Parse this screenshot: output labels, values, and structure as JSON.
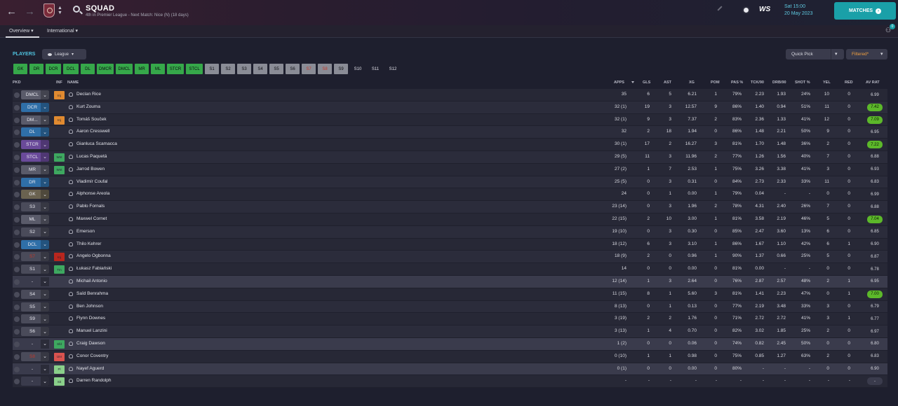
{
  "header": {
    "title": "SQUAD",
    "subtitle": "4th in Premier League - Next Match: Nice (N) (18 days)",
    "next_time": "Sat 15:00",
    "next_date": "20 May 2023",
    "opponent_logo_text": "WS",
    "matches_label": "MATCHES",
    "notif_count": "0"
  },
  "subtabs": [
    "Overview",
    "International"
  ],
  "controls": {
    "players_label": "PLAYERS",
    "league_label": "League",
    "quick_pick_label": "Quick Pick",
    "filtered_label": "Filtered*"
  },
  "position_tabs": [
    {
      "label": "GK",
      "style": "green"
    },
    {
      "label": "DR",
      "style": "green"
    },
    {
      "label": "DCR",
      "style": "green"
    },
    {
      "label": "DCL",
      "style": "green"
    },
    {
      "label": "DL",
      "style": "green"
    },
    {
      "label": "DMCR",
      "style": "green"
    },
    {
      "label": "DMCL",
      "style": "green"
    },
    {
      "label": "MR",
      "style": "green"
    },
    {
      "label": "ML",
      "style": "green"
    },
    {
      "label": "STCR",
      "style": "green"
    },
    {
      "label": "STCL",
      "style": "green"
    },
    {
      "label": "S1",
      "style": "grey"
    },
    {
      "label": "S2",
      "style": "grey"
    },
    {
      "label": "S3",
      "style": "grey"
    },
    {
      "label": "S4",
      "style": "grey"
    },
    {
      "label": "S5",
      "style": "grey"
    },
    {
      "label": "S6",
      "style": "grey"
    },
    {
      "label": "S7",
      "style": "red"
    },
    {
      "label": "S8",
      "style": "red"
    },
    {
      "label": "S9",
      "style": "grey"
    },
    {
      "label": "S10",
      "style": "dark"
    },
    {
      "label": "S11",
      "style": "dark"
    },
    {
      "label": "S12",
      "style": "dark"
    }
  ],
  "columns": [
    "PKD",
    "INF",
    "NAME",
    "APPS",
    "GLS",
    "AST",
    "XG",
    "POM",
    "PAS %",
    "TCK/90",
    "DRB/90",
    "SHOT %",
    "YEL",
    "RED",
    "AV RAT"
  ],
  "colors": {
    "accent": "#1aa0a8",
    "players_label": "#4fc3e0",
    "tab_green": "#36a84a",
    "rating_green": "#5cb82a",
    "inj": "#e08a30",
    "red_status": "#c0392b",
    "wnt": "#3ea860"
  },
  "rows": [
    {
      "pos": "DMCL",
      "pos_color": "#5a5b6a",
      "inf": "Inj",
      "inf_color": "#e08a30",
      "name": "Declan Rice",
      "apps": "35",
      "gls": "6",
      "ast": "5",
      "xg": "6.21",
      "pom": "1",
      "pas": "79%",
      "tck": "2.23",
      "drb": "1.93",
      "shot": "24%",
      "yel": "10",
      "red": "0",
      "rat": "6.99",
      "rat_hl": false,
      "row_style": "normal"
    },
    {
      "pos": "DCR",
      "pos_color": "#2f6fa8",
      "inf": "",
      "inf_color": "",
      "name": "Kurt Zouma",
      "apps": "32 (1)",
      "gls": "19",
      "ast": "3",
      "xg": "12.57",
      "pom": "9",
      "pas": "86%",
      "tck": "1.40",
      "drb": "0.94",
      "shot": "51%",
      "yel": "11",
      "red": "0",
      "rat": "7.42",
      "rat_hl": true,
      "row_style": "alt"
    },
    {
      "pos": "DM...",
      "pos_color": "#5a5b6a",
      "inf": "Inj",
      "inf_color": "#e08a30",
      "name": "Tomáš Souček",
      "apps": "32 (1)",
      "gls": "9",
      "ast": "3",
      "xg": "7.37",
      "pom": "2",
      "pas": "83%",
      "tck": "2.36",
      "drb": "1.33",
      "shot": "41%",
      "yel": "12",
      "red": "0",
      "rat": "7.09",
      "rat_hl": true,
      "row_style": "normal"
    },
    {
      "pos": "DL",
      "pos_color": "#2f6fa8",
      "inf": "",
      "inf_color": "",
      "name": "Aaron Cresswell",
      "apps": "32",
      "gls": "2",
      "ast": "18",
      "xg": "1.94",
      "pom": "0",
      "pas": "86%",
      "tck": "1.48",
      "drb": "2.21",
      "shot": "50%",
      "yel": "9",
      "red": "0",
      "rat": "6.95",
      "rat_hl": false,
      "row_style": "alt"
    },
    {
      "pos": "STCR",
      "pos_color": "#6a4a9a",
      "inf": "",
      "inf_color": "",
      "name": "Gianluca Scamacca",
      "apps": "30 (1)",
      "gls": "17",
      "ast": "2",
      "xg": "16.27",
      "pom": "3",
      "pas": "81%",
      "tck": "1.70",
      "drb": "1.48",
      "shot": "36%",
      "yel": "2",
      "red": "0",
      "rat": "7.22",
      "rat_hl": true,
      "row_style": "normal"
    },
    {
      "pos": "STCL",
      "pos_color": "#6a4a9a",
      "inf": "Wnt",
      "inf_color": "#3ea860",
      "name": "Lucas Paquetá",
      "apps": "29 (5)",
      "gls": "11",
      "ast": "3",
      "xg": "11.96",
      "pom": "2",
      "pas": "77%",
      "tck": "1.26",
      "drb": "1.56",
      "shot": "40%",
      "yel": "7",
      "red": "0",
      "rat": "6.88",
      "rat_hl": false,
      "row_style": "alt"
    },
    {
      "pos": "MR",
      "pos_color": "#5a5b6a",
      "inf": "Wnt",
      "inf_color": "#3ea860",
      "name": "Jarrod Bowen",
      "apps": "27 (2)",
      "gls": "1",
      "ast": "7",
      "xg": "2.53",
      "pom": "1",
      "pas": "75%",
      "tck": "3.26",
      "drb": "3.38",
      "shot": "41%",
      "yel": "3",
      "red": "0",
      "rat": "6.93",
      "rat_hl": false,
      "row_style": "normal"
    },
    {
      "pos": "DR",
      "pos_color": "#2f6fa8",
      "inf": "",
      "inf_color": "",
      "name": "Vladimír Coufal",
      "apps": "25 (5)",
      "gls": "0",
      "ast": "3",
      "xg": "0.31",
      "pom": "0",
      "pas": "84%",
      "tck": "2.73",
      "drb": "2.33",
      "shot": "33%",
      "yel": "11",
      "red": "0",
      "rat": "6.83",
      "rat_hl": false,
      "row_style": "alt"
    },
    {
      "pos": "GK",
      "pos_color": "#6a6250",
      "inf": "",
      "inf_color": "",
      "name": "Alphonse Areola",
      "apps": "24",
      "gls": "0",
      "ast": "1",
      "xg": "0.00",
      "pom": "1",
      "pas": "79%",
      "tck": "0.04",
      "drb": "-",
      "shot": "-",
      "yel": "0",
      "red": "0",
      "rat": "6.99",
      "rat_hl": false,
      "row_style": "normal"
    },
    {
      "pos": "S3",
      "pos_color": "#4a4b5a",
      "inf": "",
      "inf_color": "",
      "name": "Pablo Fornals",
      "apps": "23 (14)",
      "gls": "0",
      "ast": "3",
      "xg": "1.96",
      "pom": "2",
      "pas": "78%",
      "tck": "4.31",
      "drb": "2.40",
      "shot": "26%",
      "yel": "7",
      "red": "0",
      "rat": "6.88",
      "rat_hl": false,
      "row_style": "alt"
    },
    {
      "pos": "ML",
      "pos_color": "#5a5b6a",
      "inf": "",
      "inf_color": "",
      "name": "Maxwel Cornet",
      "apps": "22 (15)",
      "gls": "2",
      "ast": "10",
      "xg": "3.00",
      "pom": "1",
      "pas": "81%",
      "tck": "3.58",
      "drb": "2.19",
      "shot": "46%",
      "yel": "5",
      "red": "0",
      "rat": "7.04",
      "rat_hl": true,
      "row_style": "normal"
    },
    {
      "pos": "S2",
      "pos_color": "#4a4b5a",
      "inf": "",
      "inf_color": "",
      "name": "Emerson",
      "apps": "19 (10)",
      "gls": "0",
      "ast": "3",
      "xg": "0.30",
      "pom": "0",
      "pas": "85%",
      "tck": "2.47",
      "drb": "3.60",
      "shot": "13%",
      "yel": "6",
      "red": "0",
      "rat": "6.85",
      "rat_hl": false,
      "row_style": "alt"
    },
    {
      "pos": "DCL",
      "pos_color": "#2f6fa8",
      "inf": "",
      "inf_color": "",
      "name": "Thilo Kehrer",
      "apps": "18 (12)",
      "gls": "6",
      "ast": "3",
      "xg": "3.10",
      "pom": "1",
      "pas": "86%",
      "tck": "1.67",
      "drb": "1.10",
      "shot": "42%",
      "yel": "6",
      "red": "1",
      "rat": "6.90",
      "rat_hl": false,
      "row_style": "normal"
    },
    {
      "pos": "S7",
      "pos_color": "#4a4b5a",
      "pos_red": true,
      "inf": "Inj",
      "inf_color": "#b8261e",
      "name": "Angelo Ogbonna",
      "apps": "18 (9)",
      "gls": "2",
      "ast": "0",
      "xg": "0.96",
      "pom": "1",
      "pas": "90%",
      "tck": "1.37",
      "drb": "0.66",
      "shot": "25%",
      "yel": "5",
      "red": "0",
      "rat": "6.87",
      "rat_hl": false,
      "row_style": "alt"
    },
    {
      "pos": "S1",
      "pos_color": "#4a4b5a",
      "inf": "Trn",
      "inf_color": "#3ea860",
      "name": "Łukasz Fabiański",
      "apps": "14",
      "gls": "0",
      "ast": "0",
      "xg": "0.00",
      "pom": "0",
      "pas": "81%",
      "tck": "0.00",
      "drb": "-",
      "shot": "-",
      "yel": "0",
      "red": "0",
      "rat": "6.78",
      "rat_hl": false,
      "row_style": "normal"
    },
    {
      "pos": "-",
      "pos_color": "#3a3b4c",
      "inf": "",
      "inf_color": "",
      "name": "Michail Antonio",
      "apps": "12 (14)",
      "gls": "1",
      "ast": "3",
      "xg": "2.64",
      "pom": "0",
      "pas": "76%",
      "tck": "2.87",
      "drb": "2.57",
      "shot": "48%",
      "yel": "2",
      "red": "1",
      "rat": "6.95",
      "rat_hl": false,
      "row_style": "hl"
    },
    {
      "pos": "S4",
      "pos_color": "#4a4b5a",
      "inf": "",
      "inf_color": "",
      "name": "Saïd Benrahma",
      "apps": "11 (15)",
      "gls": "8",
      "ast": "1",
      "xg": "5.60",
      "pom": "3",
      "pas": "81%",
      "tck": "1.41",
      "drb": "2.23",
      "shot": "47%",
      "yel": "0",
      "red": "1",
      "rat": "7.00",
      "rat_hl": true,
      "row_style": "normal"
    },
    {
      "pos": "S5",
      "pos_color": "#4a4b5a",
      "inf": "",
      "inf_color": "",
      "name": "Ben Johnson",
      "apps": "8 (13)",
      "gls": "0",
      "ast": "1",
      "xg": "0.13",
      "pom": "0",
      "pas": "77%",
      "tck": "2.19",
      "drb": "3.48",
      "shot": "33%",
      "yel": "3",
      "red": "0",
      "rat": "6.79",
      "rat_hl": false,
      "row_style": "alt"
    },
    {
      "pos": "S9",
      "pos_color": "#4a4b5a",
      "inf": "",
      "inf_color": "",
      "name": "Flynn Downes",
      "apps": "3 (19)",
      "gls": "2",
      "ast": "2",
      "xg": "1.76",
      "pom": "0",
      "pas": "71%",
      "tck": "2.72",
      "drb": "2.72",
      "shot": "41%",
      "yel": "3",
      "red": "1",
      "rat": "6.77",
      "rat_hl": false,
      "row_style": "normal"
    },
    {
      "pos": "S6",
      "pos_color": "#4a4b5a",
      "inf": "",
      "inf_color": "",
      "name": "Manuel Lanzini",
      "apps": "3 (13)",
      "gls": "1",
      "ast": "4",
      "xg": "0.70",
      "pom": "0",
      "pas": "82%",
      "tck": "3.02",
      "drb": "1.85",
      "shot": "25%",
      "yel": "2",
      "red": "0",
      "rat": "6.97",
      "rat_hl": false,
      "row_style": "alt"
    },
    {
      "pos": "-",
      "pos_color": "#3a3b4c",
      "inf": "Sfd",
      "inf_color": "#3ea860",
      "name": "Craig Dawson",
      "apps": "1 (2)",
      "gls": "0",
      "ast": "0",
      "xg": "0.06",
      "pom": "0",
      "pas": "74%",
      "tck": "0.82",
      "drb": "2.45",
      "shot": "50%",
      "yel": "0",
      "red": "0",
      "rat": "6.80",
      "rat_hl": false,
      "row_style": "hl"
    },
    {
      "pos": "S8",
      "pos_color": "#4a4b5a",
      "pos_red": true,
      "inf": "Unr",
      "inf_color": "#d9534f",
      "name": "Conor Coventry",
      "apps": "0 (10)",
      "gls": "1",
      "ast": "1",
      "xg": "0.98",
      "pom": "0",
      "pas": "75%",
      "tck": "0.85",
      "drb": "1.27",
      "shot": "63%",
      "yel": "2",
      "red": "0",
      "rat": "6.83",
      "rat_hl": false,
      "row_style": "normal"
    },
    {
      "pos": "-",
      "pos_color": "#3a3b4c",
      "inf": "Pl",
      "inf_color": "#8ad08a",
      "name": "Nayef Aguerd",
      "apps": "0 (1)",
      "gls": "0",
      "ast": "0",
      "xg": "0.00",
      "pom": "0",
      "pas": "80%",
      "tck": "-",
      "drb": "-",
      "shot": "-",
      "yel": "0",
      "red": "0",
      "rat": "6.90",
      "rat_hl": false,
      "row_style": "hl"
    },
    {
      "pos": "-",
      "pos_color": "#3a3b4c",
      "inf": "Sit",
      "inf_color": "#8ad08a",
      "name": "Darren Randolph",
      "apps": "-",
      "gls": "-",
      "ast": "-",
      "xg": "-",
      "pom": "-",
      "pas": "-",
      "tck": "-",
      "drb": "-",
      "shot": "-",
      "yel": "-",
      "red": "-",
      "rat": "-",
      "rat_hl": false,
      "row_style": "normal"
    }
  ]
}
